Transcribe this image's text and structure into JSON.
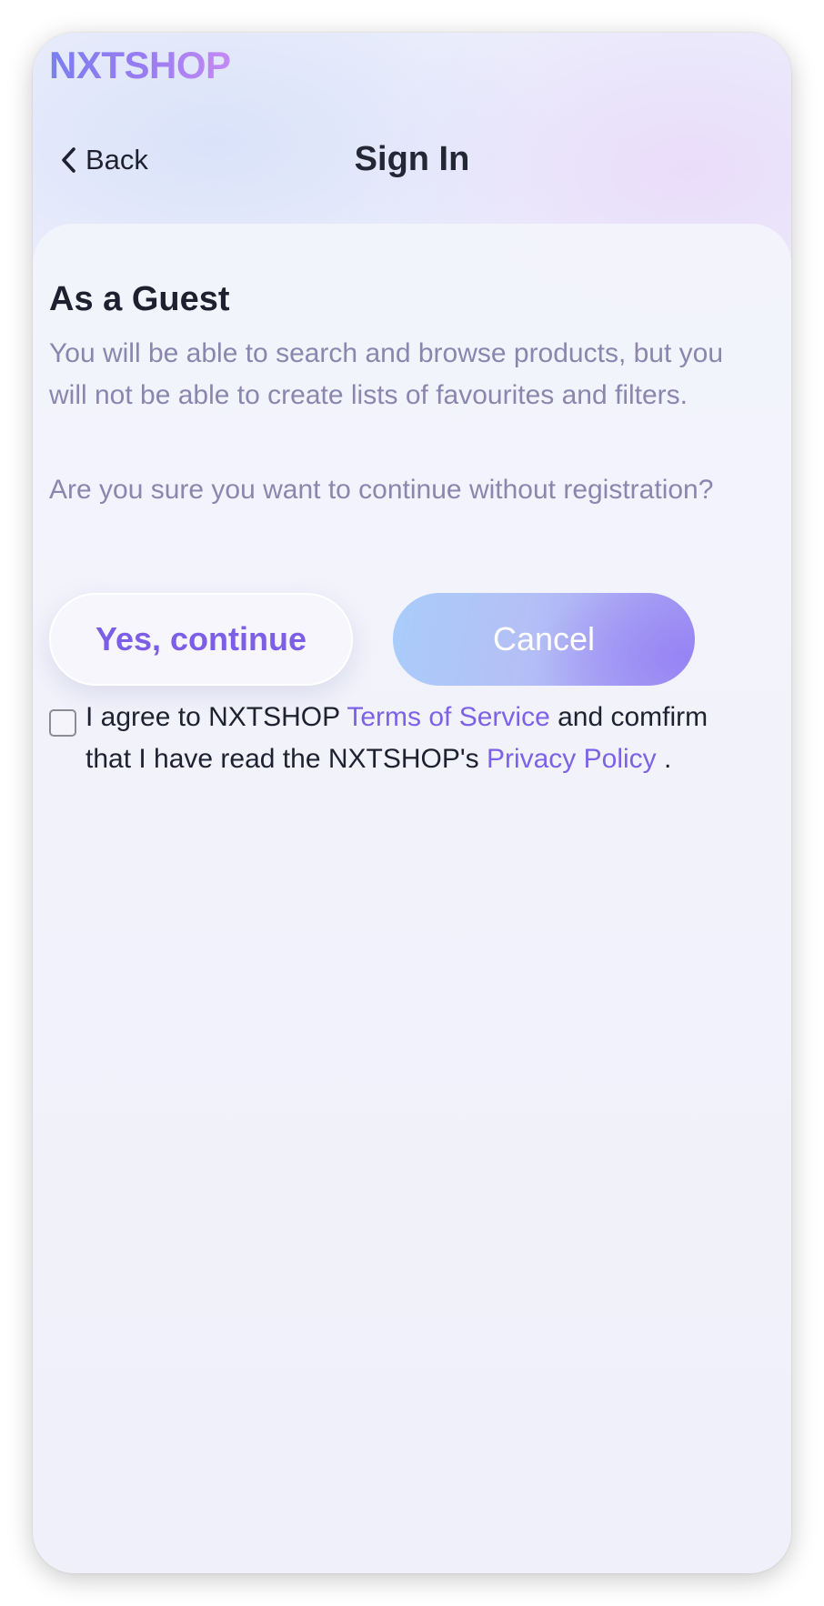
{
  "app": {
    "logo": "NXTSHOP"
  },
  "nav": {
    "back_label": "Back",
    "title": "Sign In"
  },
  "guest": {
    "heading": "As a Guest",
    "description": "You will be able to search and browse products, but you will not be able to create lists of favourites and filters.",
    "question": "Are you sure you want to continue without registration?"
  },
  "buttons": {
    "confirm_label": "Yes, continue",
    "cancel_label": "Cancel"
  },
  "agreement": {
    "checked": false,
    "text_1": "I agree to NXTSHOP ",
    "terms_link": "Terms of Service",
    "text_2": " and comfirm that I have read the NXTSHOP's ",
    "privacy_link": "Privacy Policy",
    "text_3": " ."
  },
  "colors": {
    "accent": "#7d62e8",
    "heading_text": "#1e2030",
    "muted_text": "#8a86ad"
  },
  "icons": {
    "back": "chevron-left-icon"
  }
}
